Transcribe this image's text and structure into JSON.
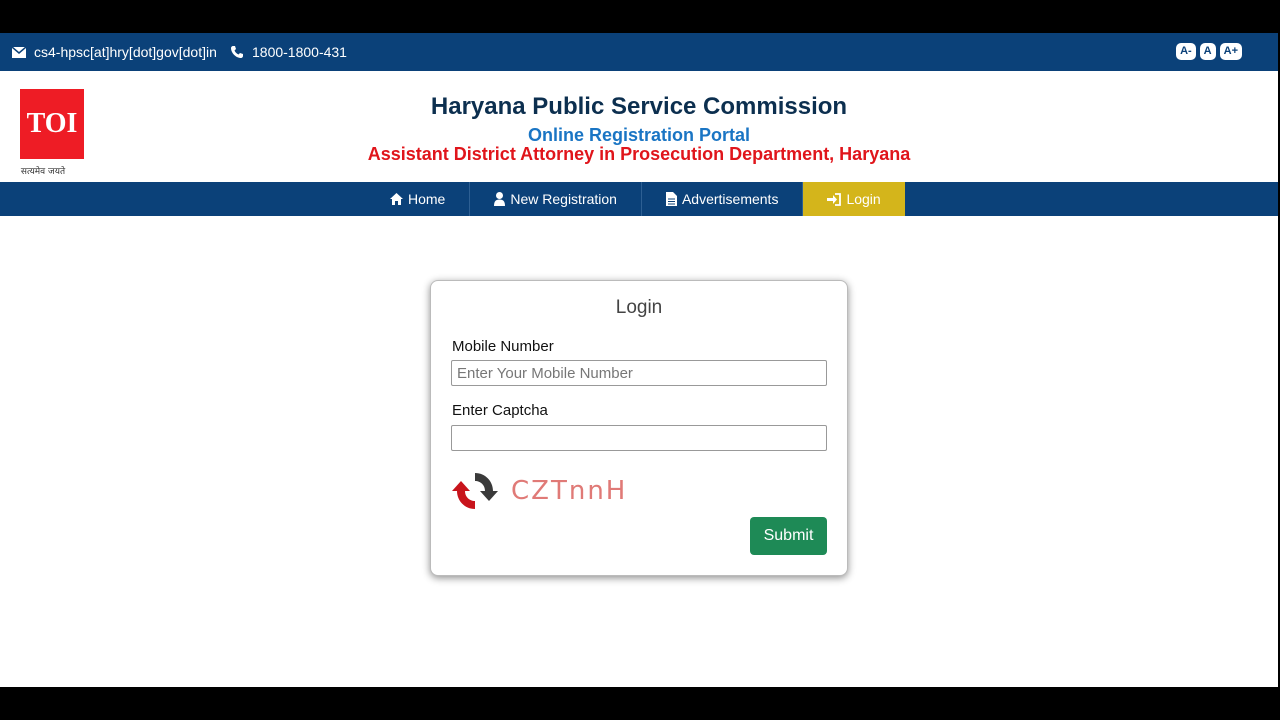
{
  "topbar": {
    "email": "cs4-hpsc[at]hry[dot]gov[dot]in",
    "phone": "1800-1800-431",
    "font_buttons": [
      "A-",
      "A",
      "A+"
    ]
  },
  "header": {
    "logo_text": "TOI",
    "emblem_motto": "सत्यमेव जयते",
    "title": "Haryana Public Service Commission",
    "subtitle": "Online Registration Portal",
    "post": "Assistant District Attorney in Prosecution Department, Haryana"
  },
  "nav": {
    "items": [
      {
        "label": "Home",
        "icon": "home-icon"
      },
      {
        "label": "New Registration",
        "icon": "user-icon"
      },
      {
        "label": "Advertisements",
        "icon": "document-icon"
      },
      {
        "label": "Login",
        "icon": "sign-in-icon",
        "active": true
      }
    ],
    "active_color": "#d4b51b",
    "bar_color": "#0b4179"
  },
  "login": {
    "title": "Login",
    "mobile_label": "Mobile Number",
    "mobile_placeholder": "Enter Your Mobile Number",
    "mobile_value": "",
    "captcha_label": "Enter Captcha",
    "captcha_value": "",
    "captcha_text": "CZTnnH",
    "submit_label": "Submit",
    "submit_color": "#1e8a56"
  }
}
